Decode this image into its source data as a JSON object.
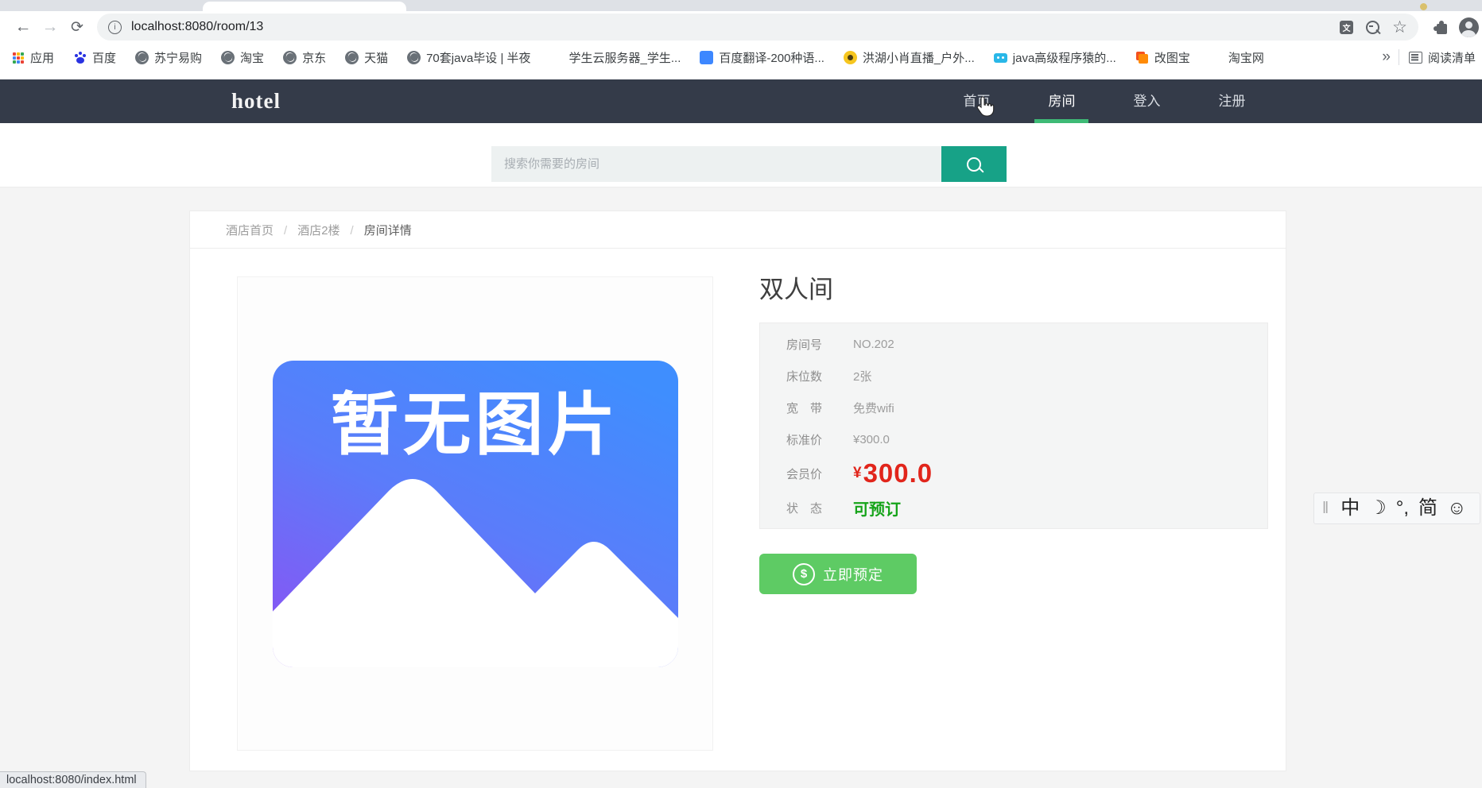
{
  "browser": {
    "toolbar": {
      "url": "localhost:8080/room/13"
    },
    "bookmarks_bar": {
      "items": [
        {
          "label": "应用",
          "icon": "apps"
        },
        {
          "label": "百度",
          "icon": "baidu"
        },
        {
          "label": "苏宁易购",
          "icon": "globe"
        },
        {
          "label": "淘宝",
          "icon": "globe"
        },
        {
          "label": "京东",
          "icon": "globe"
        },
        {
          "label": "天猫",
          "icon": "globe"
        },
        {
          "label": "70套java毕设 | 半夜",
          "icon": "globe"
        },
        {
          "label": "学生云服务器_学生...",
          "icon": "cloud"
        },
        {
          "label": "百度翻译-200种语...",
          "icon": "translate"
        },
        {
          "label": "洪湖小肖直播_户外...",
          "icon": "live"
        },
        {
          "label": "java高级程序猿的...",
          "icon": "tv"
        },
        {
          "label": "改图宝",
          "icon": "pic"
        },
        {
          "label": "淘宝网",
          "icon": "tao"
        }
      ],
      "overflow_label": "»",
      "reading_list_label": "阅读清单"
    },
    "status_bubble": "localhost:8080/index.html"
  },
  "site": {
    "logo": "hotel",
    "nav_items": [
      {
        "label": "首页"
      },
      {
        "label": "房间",
        "active": true
      },
      {
        "label": "登入"
      },
      {
        "label": "注册"
      }
    ],
    "search": {
      "placeholder": "搜索你需要的房间"
    },
    "breadcrumb": [
      {
        "label": "酒店首页"
      },
      {
        "label": "酒店2楼"
      },
      {
        "label": "房间详情",
        "type": "current"
      }
    ],
    "room": {
      "title": "双人间",
      "no_image_text": "暂无图片",
      "details": [
        {
          "label": "房间号",
          "value": "NO.202"
        },
        {
          "label": "床位数",
          "value": "2张"
        },
        {
          "label": "宽　带",
          "value": "免费wifi"
        },
        {
          "label": "标准价",
          "value": "¥300.0"
        },
        {
          "label": "会员价",
          "prefix": "¥",
          "value": "300.0",
          "type": "member"
        },
        {
          "label": "状　态",
          "value": "可预订",
          "type": "status"
        }
      ],
      "reserve_label": "立即预定"
    }
  },
  "ime_toolbar": {
    "items": [
      {
        "label": "中"
      },
      {
        "label": "☽"
      },
      {
        "label": "°,"
      },
      {
        "label": "简"
      },
      {
        "label": "☺"
      }
    ]
  },
  "colors": {
    "navbar_dark": "#343b49",
    "accent_underline_green": "#3eba76",
    "search_button_teal": "#17a287",
    "reserve_button_green": "#5ecb64",
    "member_price_red": "#e1251b",
    "status_green": "#16a41a"
  }
}
